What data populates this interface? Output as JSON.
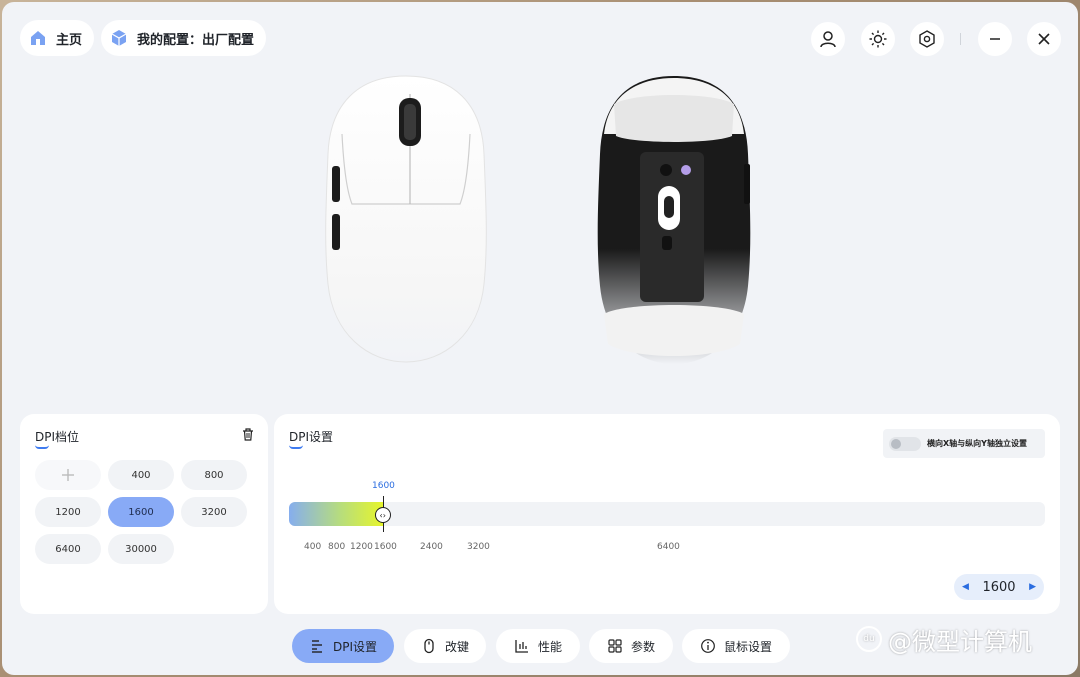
{
  "header": {
    "home_label": "主页",
    "profile_label": "我的配置：出厂配置",
    "icons": [
      "user-icon",
      "brightness-icon",
      "settings-hex-icon",
      "minimize-icon",
      "close-icon"
    ]
  },
  "dpi_levels": {
    "title": "DPI档位",
    "values": [
      "400",
      "800",
      "1200",
      "1600",
      "3200",
      "6400",
      "30000"
    ],
    "selected": "1600"
  },
  "dpi_settings": {
    "title": "DPI设置",
    "toggle_label": "横向X轴与纵向Y轴独立设置",
    "toggle_on": false,
    "current_label": "1600",
    "ticks": [
      "400",
      "800",
      "1200",
      "1600",
      "2400",
      "3200",
      "6400"
    ],
    "stepper_value": "1600",
    "slider_fraction": 0.124
  },
  "tabs": [
    {
      "label": "DPI设置",
      "active": true
    },
    {
      "label": "改键",
      "active": false
    },
    {
      "label": "性能",
      "active": false
    },
    {
      "label": "参数",
      "active": false
    },
    {
      "label": "鼠标设置",
      "active": false
    }
  ],
  "watermark": {
    "logo": "du",
    "text": "@微型计算机"
  },
  "colors": {
    "accent": "#88aaf6",
    "link_blue": "#2b6de0",
    "panel_bg": "#ffffff",
    "window_bg": "#f1f3f7"
  }
}
